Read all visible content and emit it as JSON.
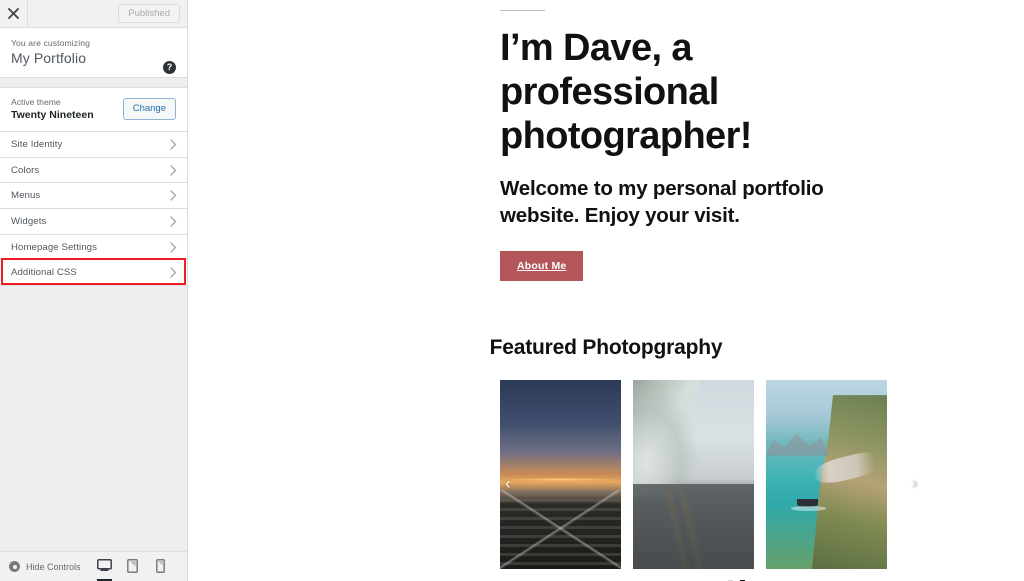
{
  "customizer": {
    "close_icon": "close-icon",
    "publish_button": "Published",
    "you_are_customizing": "You are customizing",
    "site_title": "My Portfolio",
    "help_icon": "help-icon",
    "theme": {
      "label": "Active theme",
      "name": "Twenty Nineteen",
      "change_button": "Change"
    },
    "menu_items": [
      {
        "label": "Site Identity",
        "highlighted": false
      },
      {
        "label": "Colors",
        "highlighted": false
      },
      {
        "label": "Menus",
        "highlighted": false
      },
      {
        "label": "Widgets",
        "highlighted": false
      },
      {
        "label": "Homepage Settings",
        "highlighted": false
      },
      {
        "label": "Additional CSS",
        "highlighted": true
      }
    ],
    "footer": {
      "hide_controls": "Hide Controls",
      "devices": [
        {
          "name": "desktop-preview",
          "active": true
        },
        {
          "name": "tablet-preview",
          "active": false
        },
        {
          "name": "mobile-preview",
          "active": false
        }
      ]
    },
    "highlight_color": "#ee1c25",
    "accent_color": "#2271b1"
  },
  "preview": {
    "hero": {
      "heading": "I’m Dave, a professional photographer!",
      "subheading": "Welcome to my personal portfolio website. Enjoy your visit.",
      "cta_label": "About Me",
      "cta_color": "#b4555a"
    },
    "featured": {
      "heading": "Featured Photopgraphy",
      "prev_arrow": "‹",
      "next_arrow": "›",
      "slides": [
        {
          "alt": "railroad-tracks-at-sunset"
        },
        {
          "alt": "foggy-winter-road"
        },
        {
          "alt": "coastal-cliff-road-with-boat"
        }
      ],
      "dots": [
        {
          "active": false
        },
        {
          "active": true
        }
      ]
    }
  }
}
